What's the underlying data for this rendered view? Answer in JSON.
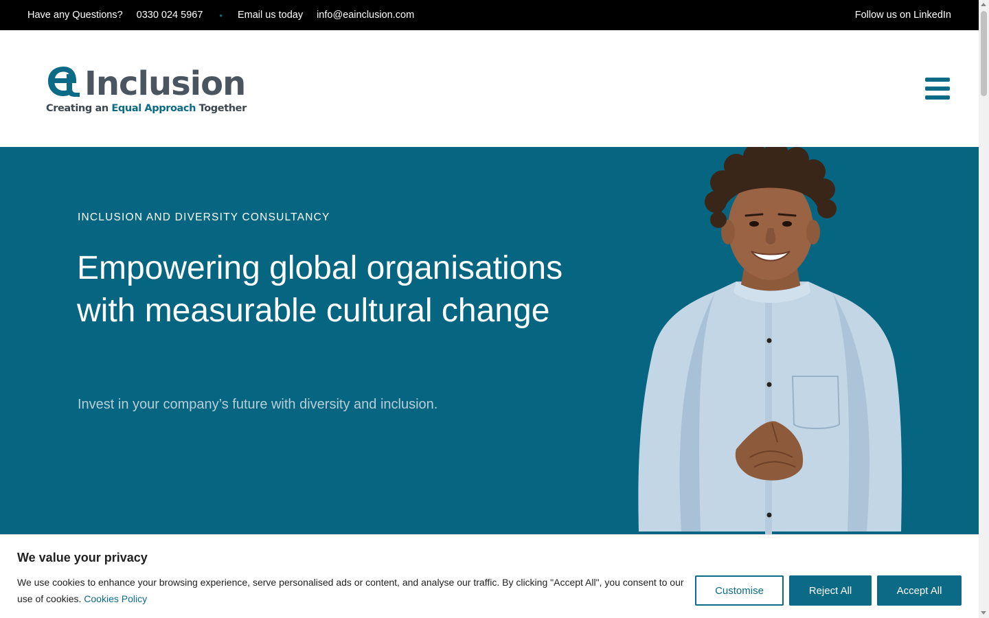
{
  "topbar": {
    "questions_label": "Have any Questions?",
    "phone": "0330 024 5967",
    "separator": "•",
    "email_label": "Email us today",
    "email": "info@eainclusion.com",
    "linkedin": "Follow us on LinkedIn"
  },
  "header": {
    "logo_word": "Inclusion",
    "logo_tag_prefix": "Creating an ",
    "logo_tag_accent": "Equal Approach",
    "logo_tag_suffix": " Together",
    "menu_icon": "hamburger-menu-icon"
  },
  "hero": {
    "eyebrow": "INCLUSION AND DIVERSITY CONSULTANCY",
    "headline": "Empowering global organisations with measurable cultural change",
    "subline": "Invest in your company’s future with diversity and inclusion.",
    "image": "smiling-man-photo"
  },
  "cookie": {
    "title": "We value your privacy",
    "text": "We use cookies to enhance your browsing experience, serve personalised ads or content, and analyse our traffic. By clicking \"Accept All\", you consent to our use of cookies. ",
    "policy_link": "Cookies Policy",
    "customise": "Customise",
    "reject": "Reject All",
    "accept": "Accept All"
  },
  "colors": {
    "brand": "#0b6a85",
    "hero_bg": "#066580",
    "topbar_bg": "#000000",
    "logo_grey": "#4b5560"
  }
}
